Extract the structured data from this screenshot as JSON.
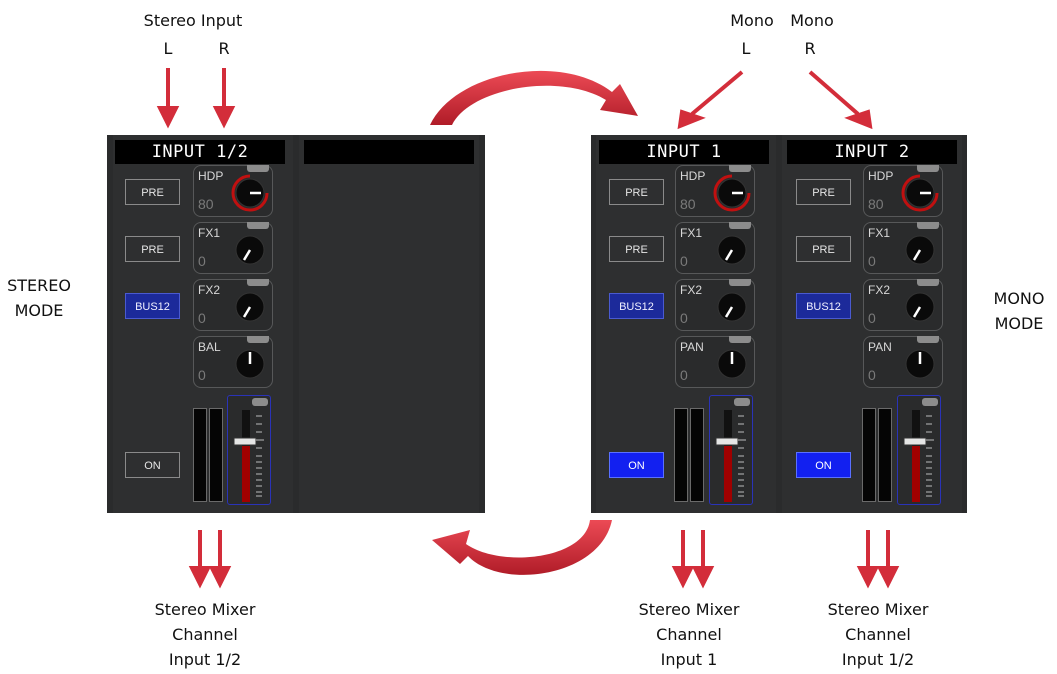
{
  "labels": {
    "stereo_input": "Stereo Input",
    "stereo_l": "L",
    "stereo_r": "R",
    "mono_l_top": "Mono",
    "mono_l": "L",
    "mono_r_top": "Mono",
    "mono_r": "R",
    "stereo_mode": "STEREO\nMODE",
    "mono_mode": "MONO\nMODE",
    "out_stereo": "Stereo Mixer\nChannel\nInput 1/2",
    "out_mono1": "Stereo Mixer\nChannel\nInput 1",
    "out_mono2": "Stereo Mixer\nChannel\nInput 1/2"
  },
  "stereo_strip": {
    "title": "INPUT 1/2",
    "second_title": "",
    "pre1": "PRE",
    "pre2": "PRE",
    "bus": "BUS12",
    "on": "ON",
    "on_active": false,
    "knobs": [
      {
        "label": "HDP",
        "value": "80",
        "icon": "hdp-knob-icon"
      },
      {
        "label": "FX1",
        "value": "0",
        "icon": "fx1-knob-icon"
      },
      {
        "label": "FX2",
        "value": "0",
        "icon": "fx2-knob-icon"
      },
      {
        "label": "BAL",
        "value": "0",
        "icon": "bal-knob-icon"
      }
    ]
  },
  "mono_strip_1": {
    "title": "INPUT 1",
    "pre1": "PRE",
    "pre2": "PRE",
    "bus": "BUS12",
    "on": "ON",
    "on_active": true,
    "knobs": [
      {
        "label": "HDP",
        "value": "80"
      },
      {
        "label": "FX1",
        "value": "0"
      },
      {
        "label": "FX2",
        "value": "0"
      },
      {
        "label": "PAN",
        "value": "0"
      }
    ]
  },
  "mono_strip_2": {
    "title": "INPUT 2",
    "pre1": "PRE",
    "pre2": "PRE",
    "bus": "BUS12",
    "on": "ON",
    "on_active": true,
    "knobs": [
      {
        "label": "HDP",
        "value": "80"
      },
      {
        "label": "FX1",
        "value": "0"
      },
      {
        "label": "FX2",
        "value": "0"
      },
      {
        "label": "PAN",
        "value": "0"
      }
    ]
  },
  "colors": {
    "arrow": "#d32d3a",
    "panel": "#2e2f30",
    "on_button": "#1220f0",
    "bus_button": "#1c2a9a",
    "hdp_ring": "#c01010",
    "fader_fill": "#a00000"
  }
}
